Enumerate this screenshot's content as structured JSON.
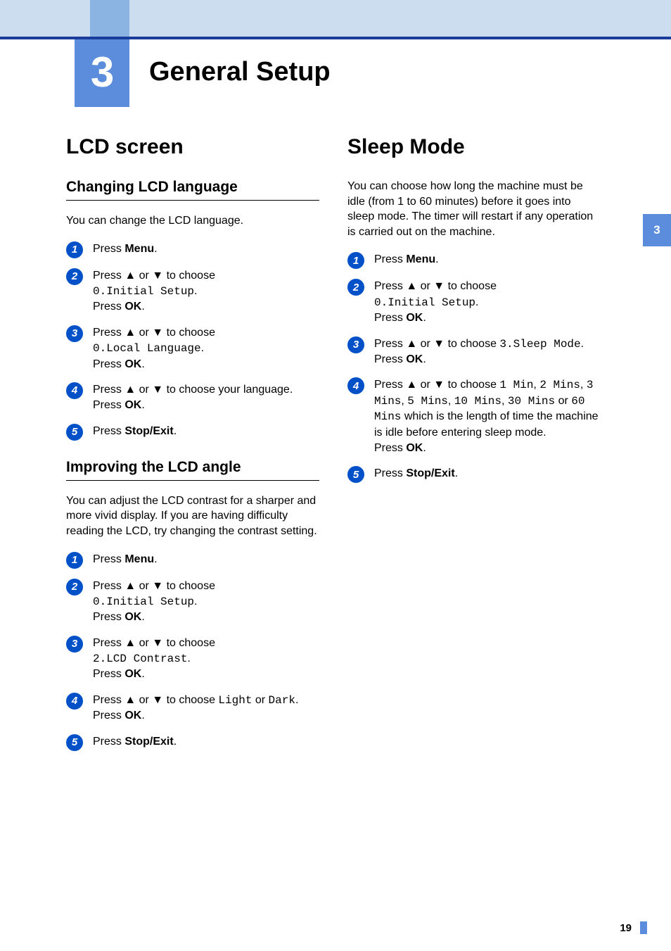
{
  "chapter": {
    "number": "3",
    "title": "General Setup"
  },
  "side_tab": "3",
  "page_number": "19",
  "left": {
    "heading": "LCD screen",
    "sec1": {
      "title": "Changing LCD language",
      "intro": "You can change the LCD language.",
      "steps": {
        "1": {
          "t1": "Press ",
          "b1": "Menu",
          "t2": "."
        },
        "2": {
          "t1": "Press a or b to choose ",
          "m1": "0.Initial Setup",
          "t2": ".",
          "br": "Press ",
          "b1": "OK",
          "t3": "."
        },
        "3": {
          "t1": "Press a or b to choose ",
          "m1": "0.Local Language",
          "t2": ".",
          "br": "Press ",
          "b1": "OK",
          "t3": "."
        },
        "4": {
          "t1": "Press a or b to choose your language.",
          "br": "Press ",
          "b1": "OK",
          "t2": "."
        },
        "5": {
          "t1": "Press ",
          "b1": "Stop/Exit",
          "t2": "."
        }
      }
    },
    "sec2": {
      "title": "Improving the LCD angle",
      "intro": "You can adjust the LCD contrast for a sharper and more vivid display. If you are having difficulty reading the LCD, try changing the contrast setting.",
      "steps": {
        "1": {
          "t1": "Press ",
          "b1": "Menu",
          "t2": "."
        },
        "2": {
          "t1": "Press a or b to choose ",
          "m1": "0.Initial Setup",
          "t2": ".",
          "br": "Press ",
          "b1": "OK",
          "t3": "."
        },
        "3": {
          "t1": "Press a or b to choose ",
          "m1": "2.LCD Contrast",
          "t2": ".",
          "br": "Press ",
          "b1": "OK",
          "t3": "."
        },
        "4": {
          "t1": "Press a or b to choose ",
          "m1": "Light",
          "t2": " or ",
          "m2": "Dark",
          "t3": ".",
          "br": "Press ",
          "b1": "OK",
          "t4": "."
        },
        "5": {
          "t1": "Press ",
          "b1": "Stop/Exit",
          "t2": "."
        }
      }
    }
  },
  "right": {
    "heading": "Sleep Mode",
    "intro": "You can choose how long the machine must be idle (from 1 to 60 minutes) before it goes into sleep mode. The timer will restart if any operation is carried out on the machine.",
    "steps": {
      "1": {
        "t1": "Press ",
        "b1": "Menu",
        "t2": "."
      },
      "2": {
        "t1": "Press a or b to choose ",
        "m1": "0.Initial Setup",
        "t2": ".",
        "br": "Press ",
        "b1": "OK",
        "t3": "."
      },
      "3": {
        "t1": "Press a or b to choose ",
        "m1": "3.Sleep Mode",
        "t2": ".",
        "br": "Press ",
        "b1": "OK",
        "t3": "."
      },
      "4": {
        "t1": "Press a or b to choose ",
        "m1": "1 Min",
        "c1": ", ",
        "m2": "2 Mins",
        "c2": ", ",
        "m3": "3 Mins",
        "c3": ", ",
        "m4": "5 Mins",
        "c4": ", ",
        "m5": "10 Mins",
        "c5": ", ",
        "m6": "30 Mins",
        "t2": " or ",
        "m7": "60 Mins",
        "t3": " which is the length of time the machine is idle before entering sleep mode.",
        "br": "Press ",
        "b1": "OK",
        "t4": "."
      },
      "5": {
        "t1": "Press ",
        "b1": "Stop/Exit",
        "t2": "."
      }
    }
  }
}
